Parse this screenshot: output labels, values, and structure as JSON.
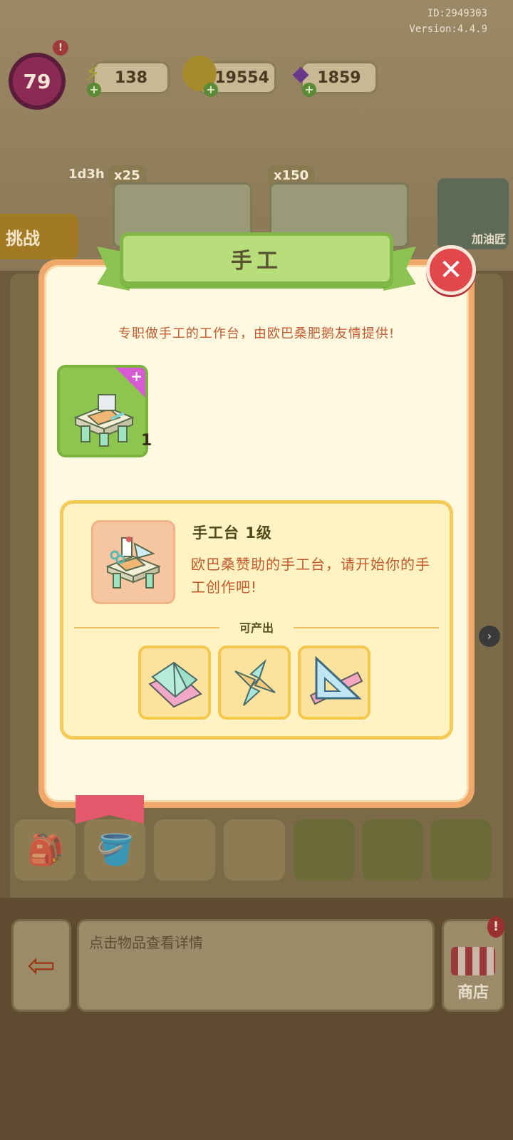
{
  "header": {
    "id_text": "ID:2949303",
    "version_text": "Version:4.4.9",
    "level": "79",
    "level_alert": "!",
    "resources": [
      {
        "name": "energy",
        "icon": "lightning-icon",
        "value": "138"
      },
      {
        "name": "coins",
        "icon": "coin-icon",
        "value": "119554"
      },
      {
        "name": "gems",
        "icon": "gem-icon",
        "value": "1859"
      }
    ],
    "timer": "1d3h",
    "costs": [
      "x25",
      "x150"
    ],
    "challenge_label": "挑战",
    "side_shop_label": "加油匠"
  },
  "modal": {
    "title": "手工",
    "close_symbol": "✕",
    "description": "专职做手工的工作台，由欧巴桑肥鹅友情提供!",
    "item": {
      "count": "1",
      "corner_symbol": "+"
    },
    "card": {
      "title": "手工台 1级",
      "text": "欧巴桑赞助的手工台，请开始你的手工创作吧!",
      "output_label": "可产出"
    },
    "outputs": [
      {
        "icon": "origami-paper-icon"
      },
      {
        "icon": "paper-shuriken-icon"
      },
      {
        "icon": "triangle-ruler-icon"
      }
    ]
  },
  "footer": {
    "hint": "点击物品查看详情",
    "shop_label": "商店",
    "shop_alert": "!"
  },
  "colors": {
    "modal_border": "#efa76a",
    "banner_green": "#b8de7c",
    "close_red": "#e2474c",
    "text_orange": "#c25a30",
    "card_yellow": "#fff3c4"
  }
}
